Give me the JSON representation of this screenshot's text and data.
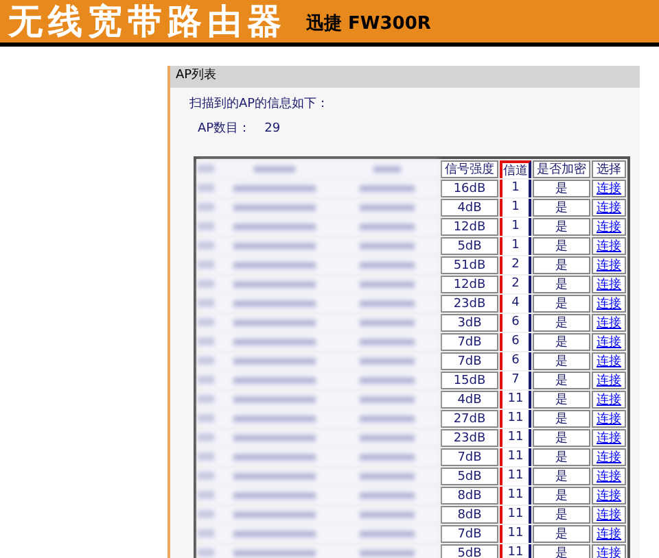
{
  "header": {
    "title": "无线宽带路由器",
    "model": "迅捷 FW300R"
  },
  "panel": {
    "title": "AP列表",
    "intro": "扫描到的AP的信息如下：",
    "count_label": "AP数目：",
    "count": "29"
  },
  "table": {
    "columns": [
      {
        "label": "信号强度",
        "highlighted": false
      },
      {
        "label": "信道",
        "highlighted": true
      },
      {
        "label": "是否加密",
        "highlighted": false
      },
      {
        "label": "选择",
        "highlighted": false
      }
    ],
    "rows": [
      {
        "signal": "16dB",
        "channel": "1",
        "encrypted": "是",
        "action": "连接"
      },
      {
        "signal": "4dB",
        "channel": "1",
        "encrypted": "是",
        "action": "连接"
      },
      {
        "signal": "12dB",
        "channel": "1",
        "encrypted": "是",
        "action": "连接"
      },
      {
        "signal": "5dB",
        "channel": "1",
        "encrypted": "是",
        "action": "连接"
      },
      {
        "signal": "51dB",
        "channel": "2",
        "encrypted": "是",
        "action": "连接"
      },
      {
        "signal": "12dB",
        "channel": "2",
        "encrypted": "是",
        "action": "连接"
      },
      {
        "signal": "23dB",
        "channel": "4",
        "encrypted": "是",
        "action": "连接"
      },
      {
        "signal": "3dB",
        "channel": "6",
        "encrypted": "是",
        "action": "连接"
      },
      {
        "signal": "7dB",
        "channel": "6",
        "encrypted": "是",
        "action": "连接"
      },
      {
        "signal": "7dB",
        "channel": "6",
        "encrypted": "是",
        "action": "连接"
      },
      {
        "signal": "15dB",
        "channel": "7",
        "encrypted": "是",
        "action": "连接"
      },
      {
        "signal": "4dB",
        "channel": "11",
        "encrypted": "是",
        "action": "连接"
      },
      {
        "signal": "27dB",
        "channel": "11",
        "encrypted": "是",
        "action": "连接"
      },
      {
        "signal": "23dB",
        "channel": "11",
        "encrypted": "是",
        "action": "连接"
      },
      {
        "signal": "7dB",
        "channel": "11",
        "encrypted": "是",
        "action": "连接"
      },
      {
        "signal": "5dB",
        "channel": "11",
        "encrypted": "是",
        "action": "连接"
      },
      {
        "signal": "8dB",
        "channel": "11",
        "encrypted": "是",
        "action": "连接"
      },
      {
        "signal": "8dB",
        "channel": "11",
        "encrypted": "是",
        "action": "连接"
      },
      {
        "signal": "7dB",
        "channel": "11",
        "encrypted": "是",
        "action": "连接"
      },
      {
        "signal": "5dB",
        "channel": "11",
        "encrypted": "是",
        "action": "连接"
      }
    ]
  }
}
